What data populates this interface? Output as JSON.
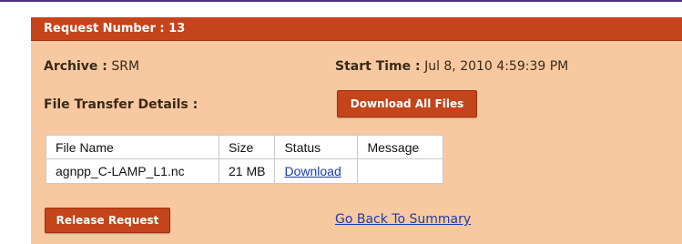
{
  "header": {
    "title": "Request Number : 13"
  },
  "archive": {
    "label": "Archive :",
    "value": "SRM"
  },
  "start_time": {
    "label": "Start Time :",
    "value": "Jul 8, 2010 4:59:39 PM"
  },
  "file_transfer_label": "File Transfer Details :",
  "download_all_label": "Download All Files",
  "table": {
    "columns": [
      "File Name",
      "Size",
      "Status",
      "Message"
    ],
    "rows": [
      {
        "file_name": "agnpp_C-LAMP_L1.nc",
        "size": "21 MB",
        "status": "Download",
        "message": ""
      }
    ]
  },
  "release_label": "Release Request",
  "back_link_label": "Go Back To Summary",
  "colors": {
    "header": "#c4441c",
    "panel": "#f8c9a0",
    "link": "#1a3da8"
  }
}
